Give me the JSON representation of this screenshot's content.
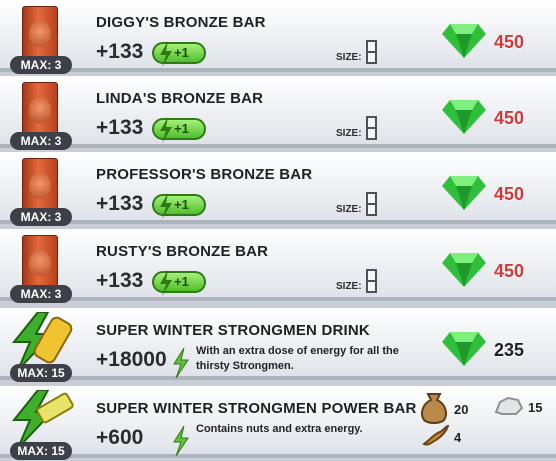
{
  "items": [
    {
      "title": "DIGGY'S BRONZE BAR",
      "energy": "+133",
      "bonus": "+1",
      "size_label": "SIZE:",
      "max": "MAX: 3",
      "price": "450"
    },
    {
      "title": "LINDA'S BRONZE BAR",
      "energy": "+133",
      "bonus": "+1",
      "size_label": "SIZE:",
      "max": "MAX: 3",
      "price": "450"
    },
    {
      "title": "PROFESSOR'S BRONZE BAR",
      "energy": "+133",
      "bonus": "+1",
      "size_label": "SIZE:",
      "max": "MAX: 3",
      "price": "450"
    },
    {
      "title": "RUSTY'S BRONZE BAR",
      "energy": "+133",
      "bonus": "+1",
      "size_label": "SIZE:",
      "max": "MAX: 3",
      "price": "450"
    },
    {
      "title": "SUPER WINTER STRONGMEN DRINK",
      "energy": "+18000",
      "desc": "With an extra dose of energy for all the thirsty Strongmen.",
      "max": "MAX: 15",
      "price": "235"
    },
    {
      "title": "SUPER WINTER STRONGMEN POWER BAR",
      "energy": "+600",
      "desc": "Contains nuts and extra energy.",
      "max": "MAX: 15",
      "materials": {
        "sack": "20",
        "stone": "15",
        "root": "4"
      }
    }
  ],
  "colors": {
    "price_red": "#d23a3a",
    "gem_green": "#2fbf3a",
    "energy_green": "#4fbf2d",
    "badge_bg": "#3d4048"
  }
}
